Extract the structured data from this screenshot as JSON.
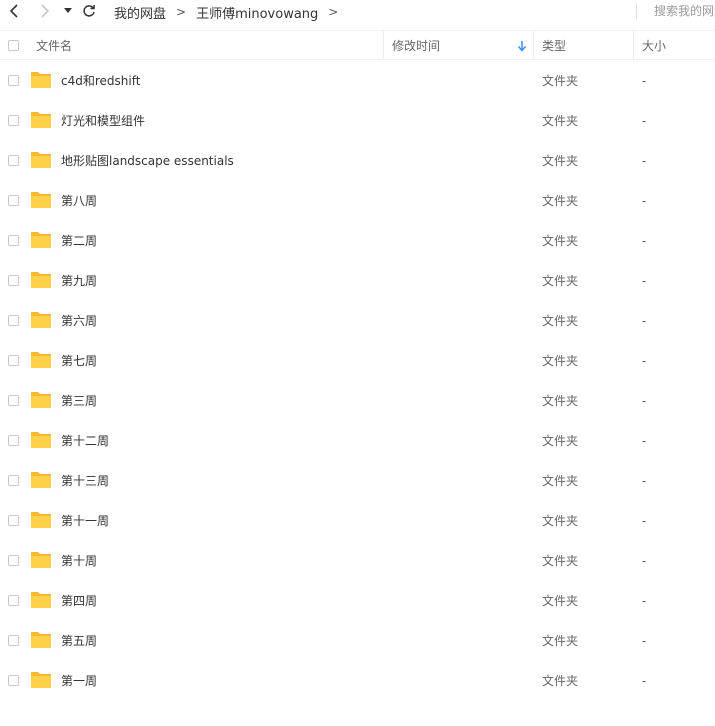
{
  "toolbar": {
    "breadcrumb": [
      "我的网盘",
      "王师傅minovowang"
    ],
    "separator": ">",
    "search_placeholder": "搜索我的网盘"
  },
  "header": {
    "name": "文件名",
    "modified": "修改时间",
    "type": "类型",
    "size": "大小"
  },
  "files": [
    {
      "name": "c4d和redshift",
      "type": "文件夹",
      "size": "-"
    },
    {
      "name": "灯光和模型组件",
      "type": "文件夹",
      "size": "-"
    },
    {
      "name": "地形贴图landscape essentials",
      "type": "文件夹",
      "size": "-"
    },
    {
      "name": "第八周",
      "type": "文件夹",
      "size": "-"
    },
    {
      "name": "第二周",
      "type": "文件夹",
      "size": "-"
    },
    {
      "name": "第九周",
      "type": "文件夹",
      "size": "-"
    },
    {
      "name": "第六周",
      "type": "文件夹",
      "size": "-"
    },
    {
      "name": "第七周",
      "type": "文件夹",
      "size": "-"
    },
    {
      "name": "第三周",
      "type": "文件夹",
      "size": "-"
    },
    {
      "name": "第十二周",
      "type": "文件夹",
      "size": "-"
    },
    {
      "name": "第十三周",
      "type": "文件夹",
      "size": "-"
    },
    {
      "name": "第十一周",
      "type": "文件夹",
      "size": "-"
    },
    {
      "name": "第十周",
      "type": "文件夹",
      "size": "-"
    },
    {
      "name": "第四周",
      "type": "文件夹",
      "size": "-"
    },
    {
      "name": "第五周",
      "type": "文件夹",
      "size": "-"
    },
    {
      "name": "第一周",
      "type": "文件夹",
      "size": "-"
    }
  ],
  "colors": {
    "folder": "#ffd04a",
    "sort_arrow": "#3b8cf0"
  },
  "icons": {
    "back": "chevron-left-icon",
    "forward": "chevron-right-icon",
    "history": "caret-down-icon",
    "refresh": "refresh-icon",
    "folder": "folder-icon",
    "sort": "arrow-down-icon"
  }
}
